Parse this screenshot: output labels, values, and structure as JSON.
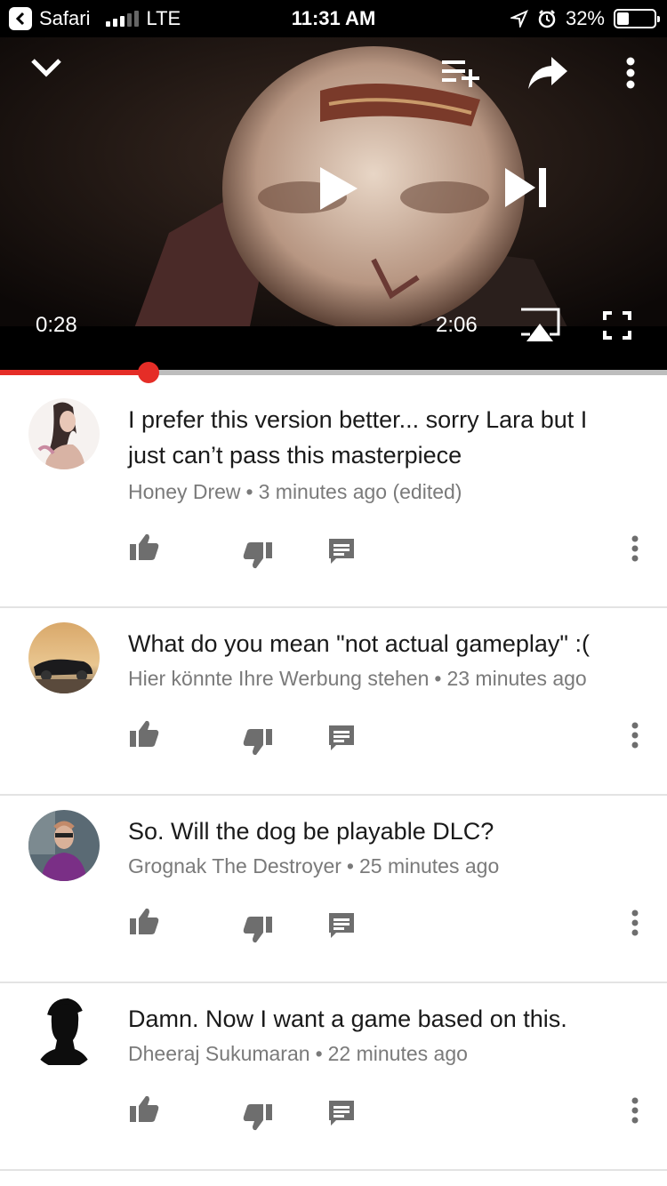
{
  "status_bar": {
    "back_app": "Safari",
    "carrier": "LTE",
    "time": "11:31 AM",
    "battery": "32%",
    "battery_level": 0.32
  },
  "player": {
    "elapsed": "0:28",
    "duration": "2:06",
    "progress": 0.222,
    "icons": {
      "collapse": "chevron-down-icon",
      "add_to_playlist": "playlist-add-icon",
      "share": "share-icon",
      "more": "more-vertical-icon",
      "play": "play-icon",
      "next": "skip-next-icon",
      "airplay": "airplay-icon",
      "fullscreen": "fullscreen-icon"
    }
  },
  "comments": [
    {
      "text": "I prefer this version better... sorry Lara but I just can’t pass this masterpiece",
      "author": "Honey Drew",
      "time": "3 minutes ago (edited)"
    },
    {
      "text": "What do you mean \"not actual gameplay\" :(",
      "author": "Hier könnte Ihre Werbung stehen",
      "time": "23 minutes ago"
    },
    {
      "text": "So. Will the dog be playable DLC?",
      "author": "Grognak The Destroyer",
      "time": "25 minutes ago"
    },
    {
      "text": "Damn. Now I want a game based on this.",
      "author": "Dheeraj Sukumaran",
      "time": "22 minutes ago"
    }
  ],
  "colors": {
    "accent": "#e52d27",
    "meta_text": "#7a7a7a",
    "icon_gray": "#6e6e6e"
  }
}
